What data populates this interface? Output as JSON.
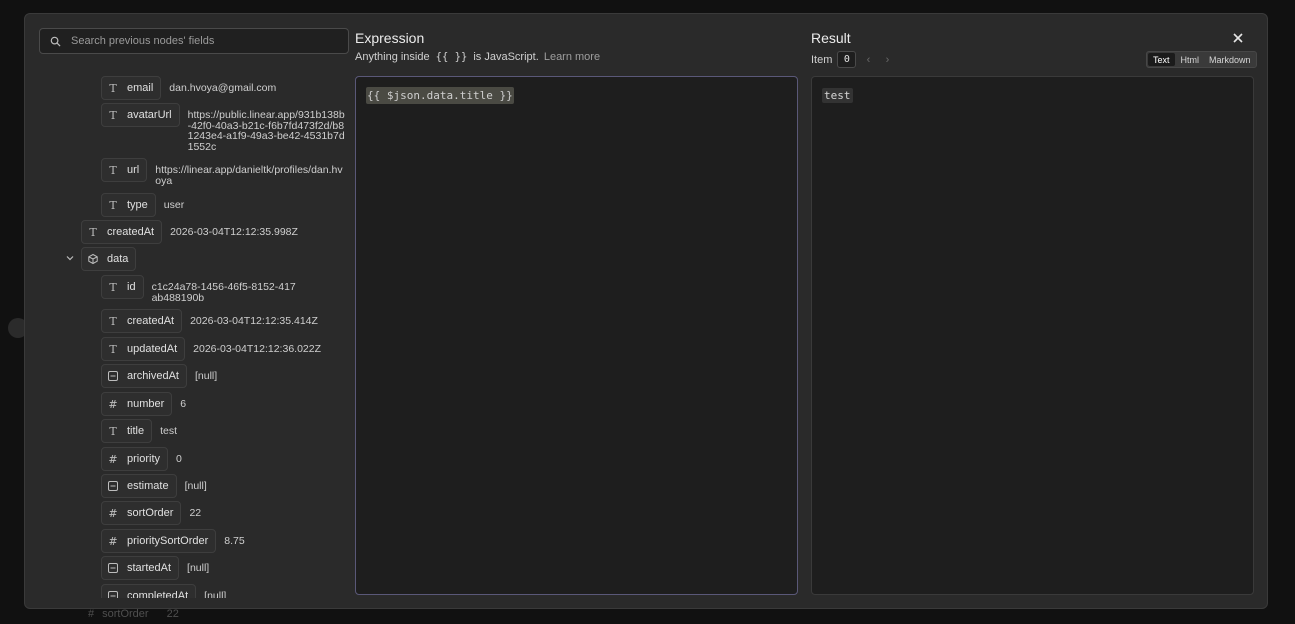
{
  "background": {
    "row_key": "sortOrder",
    "row_value": "22"
  },
  "search": {
    "placeholder": "Search previous nodes' fields",
    "value": ""
  },
  "tree": [
    {
      "type": "string",
      "icon": "T",
      "key": "email",
      "value": "dan.hvoya@gmail.com"
    },
    {
      "type": "string",
      "icon": "T",
      "key": "avatarUrl",
      "value": "https://public.linear.app/931b138b-42f0-40a3-b21c-f6b7fd473f2d/b81243e4-a1f9-49a3-be42-4531b7d1552c"
    },
    {
      "type": "string",
      "icon": "T",
      "key": "url",
      "value": "https://linear.app/danieltk/profiles/dan.hvoya"
    },
    {
      "type": "string",
      "icon": "T",
      "key": "type",
      "value": "user"
    },
    {
      "type": "string",
      "icon": "T",
      "key": "createdAt",
      "value": "2026-03-04T12:12:35.998Z"
    },
    {
      "type": "object",
      "icon": "cube",
      "key": "data",
      "value": ""
    },
    {
      "type": "string",
      "icon": "T",
      "key": "id",
      "value": "c1c24a78-1456-46f5-8152-417ab488190b"
    },
    {
      "type": "string",
      "icon": "T",
      "key": "createdAt",
      "value": "2026-03-04T12:12:35.414Z"
    },
    {
      "type": "string",
      "icon": "T",
      "key": "updatedAt",
      "value": "2026-03-04T12:12:36.022Z"
    },
    {
      "type": "null",
      "icon": "null",
      "key": "archivedAt",
      "value": "[null]"
    },
    {
      "type": "number",
      "icon": "#",
      "key": "number",
      "value": "6"
    },
    {
      "type": "string",
      "icon": "T",
      "key": "title",
      "value": "test"
    },
    {
      "type": "number",
      "icon": "#",
      "key": "priority",
      "value": "0"
    },
    {
      "type": "null",
      "icon": "null",
      "key": "estimate",
      "value": "[null]"
    },
    {
      "type": "number",
      "icon": "#",
      "key": "sortOrder",
      "value": "22"
    },
    {
      "type": "number",
      "icon": "#",
      "key": "prioritySortOrder",
      "value": "8.75"
    },
    {
      "type": "null",
      "icon": "null",
      "key": "startedAt",
      "value": "[null]"
    },
    {
      "type": "null",
      "icon": "null",
      "key": "completedAt",
      "value": "[null]"
    }
  ],
  "expression": {
    "title": "Expression",
    "subtitle_prefix": "Anything inside",
    "subtitle_braces": "{{ }}",
    "subtitle_suffix": "is JavaScript.",
    "learn_more": "Learn more",
    "code": "{{ $json.data.title }}"
  },
  "result": {
    "title": "Result",
    "item_label": "Item",
    "item_value": "0",
    "formats": [
      "Text",
      "Html",
      "Markdown"
    ],
    "active_format": "Text",
    "output": "test"
  },
  "colors": {
    "modal_bg": "#2a2a2a",
    "editor_focus_border": "#5a5878",
    "expression_highlight": "#4a4a43"
  }
}
